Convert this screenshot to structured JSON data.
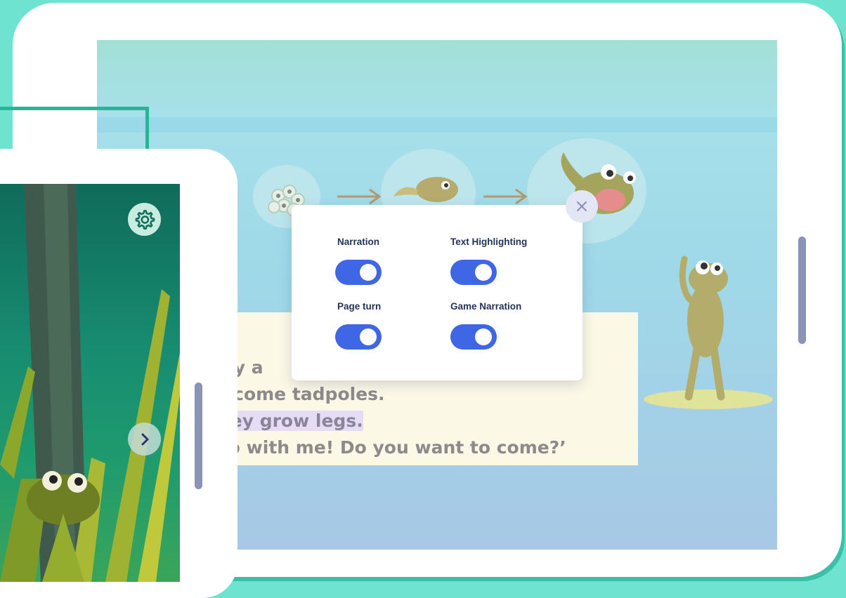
{
  "story": {
    "lines": [
      "?!’",
      "hey a",
      "oecome tadpoles.",
      "they grow legs.",
      "mp with me! Do you want to come?’"
    ],
    "highlighted_line_index": 3
  },
  "settings": {
    "narration_label": "Narration",
    "text_highlighting_label": "Text Highlighting",
    "page_turn_label": "Page turn",
    "game_narration_label": "Game Narration",
    "narration_on": true,
    "text_highlighting_on": true,
    "page_turn_on": true,
    "game_narration_on": true,
    "close_icon": "close-icon"
  },
  "controls": {
    "settings_icon": "gear-icon",
    "next_icon": "chevron-right-icon"
  },
  "colors": {
    "background": "#6ee3cf",
    "toggle_on": "#3f66e5",
    "label_text": "#23345b",
    "callout": "#2bb39a",
    "highlight": "#e5dcf5"
  }
}
